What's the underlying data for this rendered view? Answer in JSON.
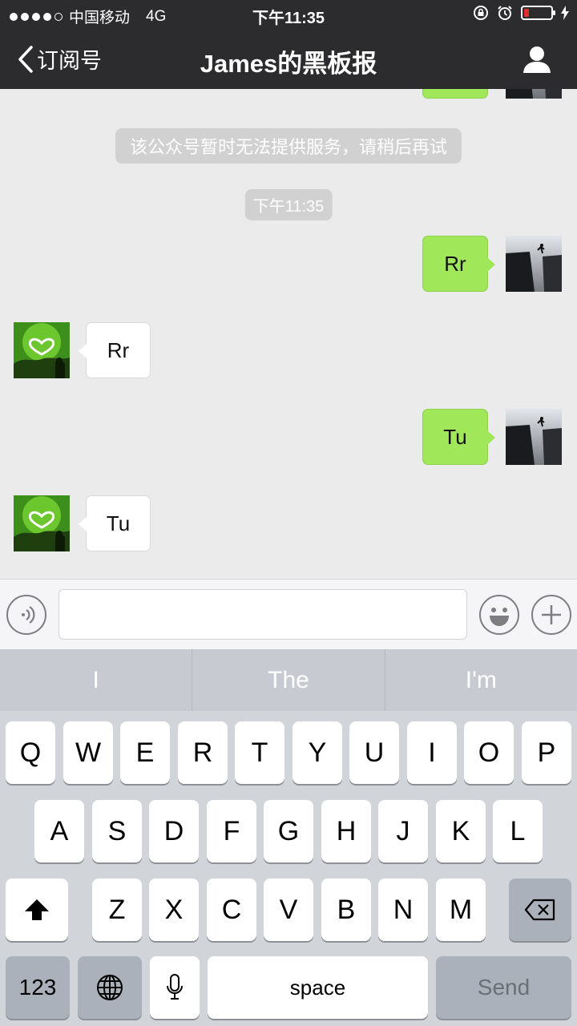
{
  "status_bar": {
    "carrier": "中国移动",
    "network": "4G",
    "time": "下午11:35"
  },
  "nav": {
    "back_label": "订阅号",
    "title": "James的黑板报"
  },
  "chat": {
    "system_notice": "该公众号暂时无法提供服务，请稍后再试",
    "timestamp": "下午11:35",
    "messages": [
      {
        "direction": "out",
        "text": "Rr"
      },
      {
        "direction": "in",
        "text": "Rr"
      },
      {
        "direction": "out",
        "text": "Tu"
      },
      {
        "direction": "in",
        "text": "Tu"
      }
    ]
  },
  "keyboard": {
    "suggestions": [
      "I",
      "The",
      "I'm"
    ],
    "row1": [
      "Q",
      "W",
      "E",
      "R",
      "T",
      "Y",
      "U",
      "I",
      "O",
      "P"
    ],
    "row2": [
      "A",
      "S",
      "D",
      "F",
      "G",
      "H",
      "J",
      "K",
      "L"
    ],
    "row3": [
      "Z",
      "X",
      "C",
      "V",
      "B",
      "N",
      "M"
    ],
    "numbers_key": "123",
    "space_key": "space",
    "send_key": "Send"
  },
  "colors": {
    "header_bg": "#2c2c2e",
    "chat_bg": "#ebebeb",
    "outgoing_bubble": "#a0e75a",
    "battery_low": "#e0302a"
  }
}
